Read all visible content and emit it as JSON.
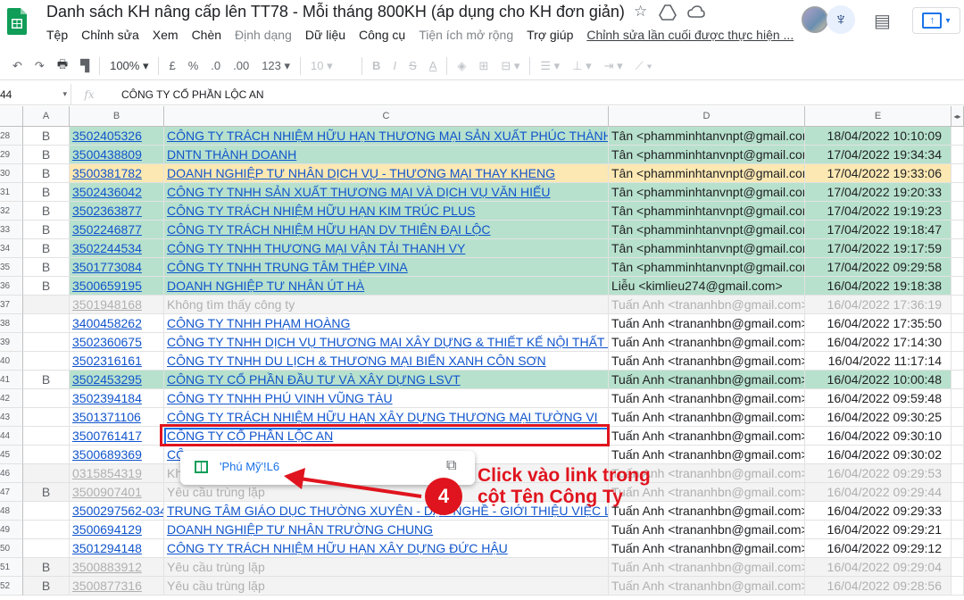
{
  "header": {
    "doc_title": "Danh sách KH nâng cấp lên TT78 - Mỗi tháng 800KH (áp dụng cho KH đơn giản)",
    "menu": [
      {
        "label": "Tệp",
        "dim": false
      },
      {
        "label": "Chỉnh sửa",
        "dim": false
      },
      {
        "label": "Xem",
        "dim": false
      },
      {
        "label": "Chèn",
        "dim": false
      },
      {
        "label": "Định dạng",
        "dim": true
      },
      {
        "label": "Dữ liệu",
        "dim": false
      },
      {
        "label": "Công cụ",
        "dim": false
      },
      {
        "label": "Tiện ích mở rộng",
        "dim": true
      },
      {
        "label": "Trợ giúp",
        "dim": false
      }
    ],
    "last_edit": "Chỉnh sửa lần cuối được thực hiện ...",
    "icons": [
      "star-icon",
      "move-to-drive-icon",
      "cloud-status-icon",
      "comment-icon",
      "share-icon"
    ]
  },
  "toolbar": {
    "zoom": "100%",
    "currency": "£",
    "percent": "%",
    "dec_dec": ".0",
    "dec_inc": ".00",
    "more_formats": "123",
    "font_size": "10",
    "bold": "B",
    "italic": "I",
    "strike": "S",
    "text_color": "A"
  },
  "formula_bar": {
    "name_box": "44",
    "fx": "fx",
    "content": "CÔNG TY CỔ PHẦN LỘC AN"
  },
  "columns": [
    "A",
    "B",
    "C",
    "D",
    "E"
  ],
  "rows": [
    {
      "n": "28",
      "a": "B",
      "b": "3502405326",
      "c": "CÔNG TY TRÁCH NHIỆM HỮU HẠN THƯƠNG MẠI SẢN XUẤT PHÚC THÀNH QT",
      "d": "Tân <phamminhtanvnpt@gmail.com>",
      "e": "18/04/2022 10:10:09",
      "style": "green"
    },
    {
      "n": "29",
      "a": "B",
      "b": "3500438809",
      "c": "DNTN THÀNH DOANH",
      "d": "Tân <phamminhtanvnpt@gmail.com>",
      "e": "17/04/2022 19:34:34",
      "style": "green"
    },
    {
      "n": "30",
      "a": "B",
      "b": "3500381782",
      "c": "DOANH NGHIỆP TƯ NHÂN DỊCH VỤ - THƯƠNG MẠI THAY KHENG",
      "d": "Tân <phamminhtanvnpt@gmail.com>",
      "e": "17/04/2022 19:33:06",
      "style": "orange"
    },
    {
      "n": "31",
      "a": "B",
      "b": "3502436042",
      "c": "CÔNG TY TNHH SẢN XUẤT THƯƠNG MẠI VÀ DỊCH VỤ VĂN HIẾU",
      "d": "Tân <phamminhtanvnpt@gmail.com>",
      "e": "17/04/2022 19:20:33",
      "style": "green"
    },
    {
      "n": "32",
      "a": "B",
      "b": "3502363877",
      "c": "CÔNG TY TRÁCH NHIỆM HỮU HẠN KIM TRÚC PLUS",
      "d": "Tân <phamminhtanvnpt@gmail.com>",
      "e": "17/04/2022 19:19:23",
      "style": "green"
    },
    {
      "n": "33",
      "a": "B",
      "b": "3502246877",
      "c": "CÔNG TY TRÁCH NHIỆM HỮU HẠN DV THIÊN ĐẠI LỘC",
      "d": "Tân <phamminhtanvnpt@gmail.com>",
      "e": "17/04/2022 19:18:47",
      "style": "green"
    },
    {
      "n": "34",
      "a": "B",
      "b": "3502244534",
      "c": "CÔNG TY TNHH THƯƠNG MẠI VẬN TẢI THANH VY",
      "d": "Tân <phamminhtanvnpt@gmail.com>",
      "e": "17/04/2022 19:17:59",
      "style": "green"
    },
    {
      "n": "35",
      "a": "B",
      "b": "3501773084",
      "c": "CÔNG TY TNHH TRUNG TÂM THÉP VINA",
      "d": "Tân <phamminhtanvnpt@gmail.com>",
      "e": "17/04/2022 09:29:58",
      "style": "green"
    },
    {
      "n": "36",
      "a": "B",
      "b": "3500659195",
      "c": "DOANH NGHIỆP TƯ NHÂN ÚT HÀ",
      "d": "Liễu <kimlieu274@gmail.com>",
      "e": "16/04/2022 19:18:38",
      "style": "green"
    },
    {
      "n": "37",
      "a": "",
      "b": "3501948168",
      "c": "Không tìm thấy công ty",
      "d": "Tuấn Anh <trananhbn@gmail.com>",
      "e": "16/04/2022 17:36:19",
      "style": "gray"
    },
    {
      "n": "38",
      "a": "",
      "b": "3400458262",
      "c": "CÔNG TY TNHH PHẠM HOÀNG",
      "d": "Tuấn Anh <trananhbn@gmail.com>",
      "e": "16/04/2022 17:35:50",
      "style": "plain"
    },
    {
      "n": "39",
      "a": "",
      "b": "3502360675",
      "c": "CÔNG TY TNHH DỊCH VỤ THƯƠNG MẠI XÂY DỰNG & THIẾT KẾ NỘI THẤT THÀ",
      "d": "Tuấn Anh <trananhbn@gmail.com>",
      "e": "16/04/2022 17:14:30",
      "style": "plain"
    },
    {
      "n": "40",
      "a": "",
      "b": "3502316161",
      "c": "CÔNG TY TNHH DU LỊCH & THƯƠNG MẠI BIỂN XANH CÔN SƠN",
      "d": "Tuấn Anh <trananhbn@gmail.com>",
      "e": "16/04/2022 11:17:14",
      "style": "plain"
    },
    {
      "n": "41",
      "a": "B",
      "b": "3502453295",
      "c": "CÔNG TY CỔ PHẦN ĐẦU TƯ VÀ XÂY DỰNG LSVT",
      "d": "Tuấn Anh <trananhbn@gmail.com>",
      "e": "16/04/2022 10:00:48",
      "style": "green"
    },
    {
      "n": "42",
      "a": "",
      "b": "3502394184",
      "c": "CÔNG TY TNHH PHÚ VINH VŨNG TÀU",
      "d": "Tuấn Anh <trananhbn@gmail.com>",
      "e": "16/04/2022 09:59:48",
      "style": "plain"
    },
    {
      "n": "43",
      "a": "",
      "b": "3501371106",
      "c": "CÔNG TY TRÁCH NHIỆM HỮU HẠN XÂY DỰNG THƯƠNG MẠI TƯỜNG VI",
      "d": "Tuấn Anh <trananhbn@gmail.com>",
      "e": "16/04/2022 09:30:25",
      "style": "plain"
    },
    {
      "n": "44",
      "a": "",
      "b": "3500761417",
      "c": "CÔNG TY CỔ PHẦN LỘC AN",
      "d": "Tuấn Anh <trananhbn@gmail.com>",
      "e": "16/04/2022 09:30:10",
      "style": "plain"
    },
    {
      "n": "45",
      "a": "",
      "b": "3500689369",
      "c": "CÔ",
      "d": "Tuấn Anh <trananhbn@gmail.com>",
      "e": "16/04/2022 09:30:02",
      "style": "plain"
    },
    {
      "n": "46",
      "a": "",
      "b": "0315854319",
      "c": "Kh",
      "d": "Tuấn Anh <trananhbn@gmail.com>",
      "e": "16/04/2022 09:29:53",
      "style": "gray"
    },
    {
      "n": "47",
      "a": "B",
      "b": "3500907401",
      "c": "Yêu cầu trùng lặp",
      "d": "Tuấn Anh <trananhbn@gmail.com>",
      "e": "16/04/2022 09:29:44",
      "style": "gray"
    },
    {
      "n": "48",
      "a": "",
      "b": "3500297562-034",
      "c": "TRUNG TÂM GIÁO DỤC THƯỜNG XUYÊN - DẠY NGHỀ - GIỚI THIỆU VIỆC LÀM",
      "d": "Tuấn Anh <trananhbn@gmail.com>",
      "e": "16/04/2022 09:29:33",
      "style": "plain"
    },
    {
      "n": "49",
      "a": "",
      "b": "3500694129",
      "c": "DOANH NGHIỆP TƯ NHÂN TRƯỜNG CHUNG",
      "d": "Tuấn Anh <trananhbn@gmail.com>",
      "e": "16/04/2022 09:29:21",
      "style": "plain"
    },
    {
      "n": "50",
      "a": "",
      "b": "3501294148",
      "c": "CÔNG TY TRÁCH NHIỆM HỮU HẠN XÂY DỰNG ĐỨC HẬU",
      "d": "Tuấn Anh <trananhbn@gmail.com>",
      "e": "16/04/2022 09:29:12",
      "style": "plain"
    },
    {
      "n": "51",
      "a": "B",
      "b": "3500883912",
      "c": "Yêu cầu trùng lặp",
      "d": "Tuấn Anh <trananhbn@gmail.com>",
      "e": "16/04/2022 09:29:04",
      "style": "gray"
    },
    {
      "n": "52",
      "a": "B",
      "b": "3500877316",
      "c": "Yêu cầu trùng lặp",
      "d": "Tuấn Anh <trananhbn@gmail.com>",
      "e": "16/04/2022 09:28:56",
      "style": "gray"
    }
  ],
  "link_popup": {
    "text": "'Phú Mỹ'!L6",
    "icon": "sheets-grid-icon",
    "copy_icon": "copy-icon"
  },
  "annotation": {
    "step": "4",
    "line1": "Click vào link trong",
    "line2": "cột Tên Công Ty",
    "color": "#e0141e"
  },
  "colors": {
    "green": "#b7e1cd",
    "orange": "#fce8b2",
    "gray": "#f3f3f3",
    "link": "#1155cc",
    "select": "#1a73e8"
  }
}
